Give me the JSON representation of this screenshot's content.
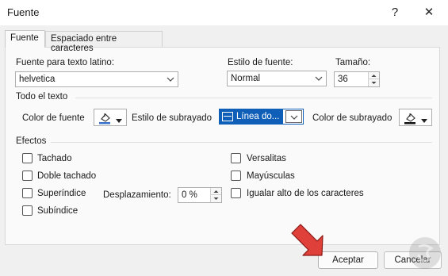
{
  "window": {
    "title": "Fuente",
    "help_glyph": "?",
    "close_glyph": "✕"
  },
  "tabs": [
    {
      "label": "Fuente",
      "active": true
    },
    {
      "label": "Espaciado entre caracteres",
      "active": false
    }
  ],
  "font": {
    "latin_label": "Fuente para texto latino:",
    "latin_value": "helvetica",
    "style_label": "Estilo de fuente:",
    "style_value": "Normal",
    "size_label": "Tamaño:",
    "size_value": "36"
  },
  "all_text": {
    "section_label": "Todo el texto",
    "font_color_label": "Color de fuente",
    "underline_style_label": "Estilo de subrayado",
    "underline_style_value": "Línea do...",
    "underline_color_label": "Color de subrayado"
  },
  "effects": {
    "section_label": "Efectos",
    "tachado": "Tachado",
    "doble_tachado": "Doble tachado",
    "superindice": "Superíndice",
    "subindice": "Subíndice",
    "desplazamiento_label": "Desplazamiento:",
    "desplazamiento_value": "0 %",
    "versalitas": "Versalitas",
    "mayusculas": "Mayúsculas",
    "igualar": "Igualar alto de los caracteres"
  },
  "buttons": {
    "accept": "Aceptar",
    "cancel": "Cancelar"
  },
  "colors": {
    "accent": "#0f5fb8",
    "pointer_arrow": "#e0403a"
  }
}
